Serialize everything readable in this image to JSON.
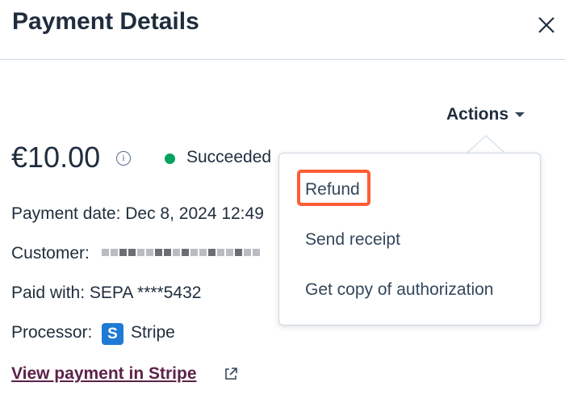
{
  "header": {
    "title": "Payment Details"
  },
  "actions": {
    "label": "Actions"
  },
  "payment": {
    "amount": "€10.00",
    "status": "Succeeded",
    "date_text": "Payment date: Dec 8, 2024 12:49",
    "customer_label": "Customer:",
    "paid_with_text": "Paid with: SEPA ****5432",
    "processor_label": "Processor:",
    "processor_logo_letter": "S",
    "processor_name": "Stripe",
    "view_link": "View payment in Stripe"
  },
  "menu": {
    "items": [
      {
        "label": "Refund",
        "highlighted": true
      },
      {
        "label": "Send receipt"
      },
      {
        "label": "Get copy of authorization"
      }
    ]
  },
  "colors": {
    "status_green": "#00a35c",
    "highlight_orange": "#ff5c35",
    "link_color": "#5c2248",
    "stripe_blue": "#1f7ad6"
  },
  "icons": [
    "close-icon",
    "info-icon",
    "status-dot-icon",
    "chevron-down-icon",
    "stripe-logo-icon",
    "external-link-icon"
  ]
}
